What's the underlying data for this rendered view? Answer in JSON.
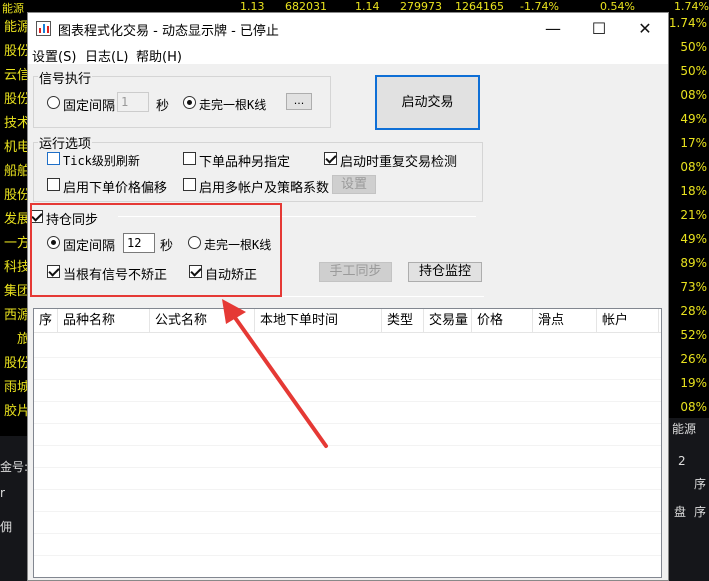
{
  "background_app": {
    "top_strip": [
      "能源",
      "1.13",
      "682031",
      "1.14",
      "279973",
      "1264165",
      "-1.74%",
      "0.54%",
      "1.74%"
    ],
    "left_names": [
      "能源",
      "股份",
      "云信",
      "股份",
      "技术",
      "机电",
      "船舶",
      "股份",
      "发展",
      "一方",
      "科技",
      "集团",
      "西源",
      "旅",
      "股份",
      "雨城",
      "胶片"
    ],
    "right_values": [
      "1.74%",
      "50%",
      "50%",
      "08%",
      "49%",
      "17%",
      "08%",
      "18%",
      "21%",
      "49%",
      "89%",
      "73%",
      "28%",
      "52%",
      "26%",
      "19%",
      "08%"
    ],
    "bottom_left": [
      "金号:",
      "r",
      "佣"
    ],
    "bottom_right": [
      "能源",
      "2",
      "序",
      "盘",
      "序"
    ]
  },
  "window": {
    "title": "图表程式化交易 - 动态显示牌 - 已停止",
    "controls": {
      "minimize": "—",
      "maximize": "☐",
      "close": "✕"
    }
  },
  "menu": [
    "设置(S)",
    "日志(L)",
    "帮助(H)"
  ],
  "signal": {
    "group_label": "信号执行",
    "fixed_interval_label": "固定间隔",
    "interval_value": "1",
    "seconds_label": "秒",
    "bar_close_label": "走完一根K线",
    "browse_label": "...",
    "start_button": "启动交易"
  },
  "options": {
    "group_label": "运行选项",
    "tick_refresh": "Tick级别刷新",
    "order_symbol": "下单品种另指定",
    "startup_check": "启动时重复交易检测",
    "price_offset": "启用下单价格偏移",
    "multi_account": "启用多帐户及策略系数",
    "settings_button": "设置"
  },
  "position_sync": {
    "label": "持仓同步",
    "fixed_interval_label": "固定间隔",
    "interval_value": "12",
    "seconds_label": "秒",
    "bar_close_label": "走完一根K线",
    "no_correct_label": "当根有信号不矫正",
    "auto_correct_label": "自动矫正",
    "manual_sync_button": "手工同步",
    "monitor_button": "持仓监控"
  },
  "table": {
    "columns": [
      "序",
      "品种名称",
      "公式名称",
      "本地下单时间",
      "类型",
      "交易量",
      "价格",
      "滑点",
      "帐户"
    ]
  },
  "colors": {
    "accent": "#0f6fd6",
    "highlight": "#e53935",
    "ticker": "#e9e21e"
  }
}
